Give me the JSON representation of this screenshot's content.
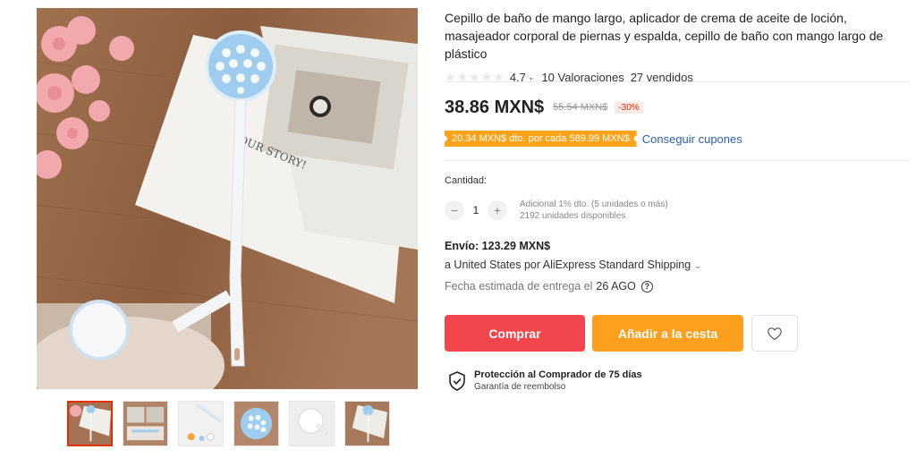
{
  "product": {
    "title": "Cepillo de baño de mango largo, aplicador de crema de aceite de loción, masajeador corporal de piernas y espalda, cepillo de baño con mango largo de plástico",
    "rating": "4.7",
    "reviews": "10 Valoraciones",
    "sold": "27 vendidos",
    "star_fill_fraction": 0
  },
  "price": {
    "current": "38.86 MXN$",
    "original": "55.54 MXN$",
    "discount": "-30%"
  },
  "coupon": {
    "text": "20.34 MXN$ dto. por cada 589.99 MXN$",
    "link": "Conseguir cupones"
  },
  "quantity": {
    "label": "Cantidad:",
    "value": "1",
    "minus": "−",
    "plus": "+",
    "note_discount": "Adicional 1% dto. (5 unidades o más)",
    "note_stock": "2192 unidades disponibles"
  },
  "shipping": {
    "title": "Envío: 123.29 MXN$",
    "destination": "a United States por AliExpress Standard Shipping",
    "delivery_label": "Fecha estimada de entrega el",
    "delivery_date": "26 AGO"
  },
  "actions": {
    "buy": "Comprar",
    "cart": "Añadir a la cesta"
  },
  "protection": {
    "title": "Protección al Comprador de 75 días",
    "subtitle": "Garantía de reembolso"
  },
  "colors": {
    "buy": "#f2464c",
    "cart": "#fea01e",
    "coupon": "#ffa31a",
    "discount": "#e62e04",
    "link": "#2e5fb3"
  },
  "icons": [
    "star-icon",
    "chevron-down-icon",
    "help-icon",
    "heart-icon",
    "shield-check-icon"
  ]
}
